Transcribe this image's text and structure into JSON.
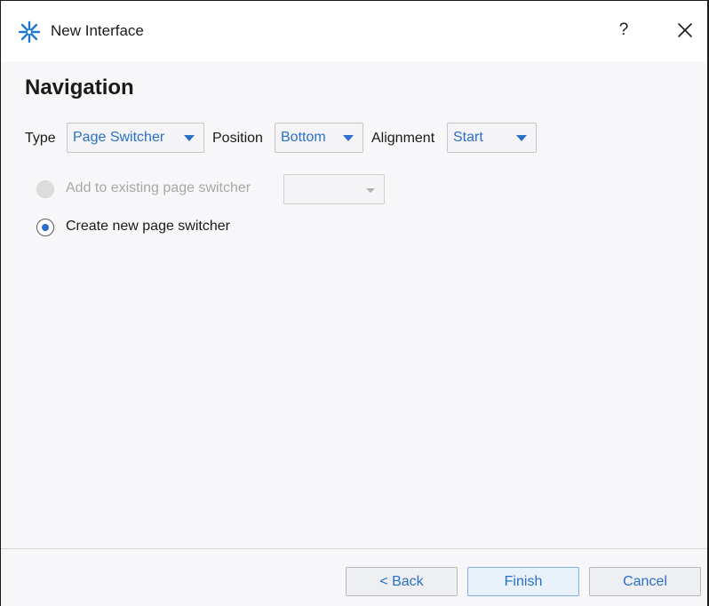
{
  "window": {
    "title": "New Interface",
    "help_label": "?",
    "app_icon": "snowflake-asterisk-icon",
    "close_icon": "close-icon"
  },
  "page": {
    "heading": "Navigation"
  },
  "options": {
    "type_label": "Type",
    "type_value": "Page Switcher",
    "position_label": "Position",
    "position_value": "Bottom",
    "alignment_label": "Alignment",
    "alignment_value": "Start"
  },
  "radios": {
    "add_existing_label": "Add to existing page switcher",
    "add_existing_enabled": false,
    "add_existing_selected": false,
    "existing_switcher_value": "",
    "create_new_label": "Create new page switcher",
    "create_new_selected": true
  },
  "footer": {
    "back_label": "< Back",
    "finish_label": "Finish",
    "cancel_label": "Cancel"
  },
  "colors": {
    "accent": "#2a6fc9",
    "background": "#f7f7f9",
    "text": "#1a1a1a",
    "disabled_text": "#a8a8a8"
  }
}
